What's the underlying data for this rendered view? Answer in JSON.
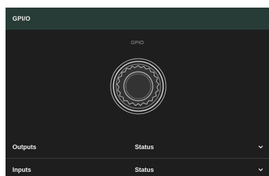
{
  "panel": {
    "title": "GPI/O"
  },
  "connector": {
    "label": "GPIO",
    "icon": "gpio-connector-icon"
  },
  "sections": [
    {
      "name": "Outputs",
      "status_label": "Status",
      "icon": "chevron-down-icon"
    },
    {
      "name": "Inputs",
      "status_label": "Status",
      "icon": "chevron-down-icon"
    }
  ],
  "colors": {
    "header_bg": "#273c36",
    "panel_bg": "#1e1e1e",
    "text": "#f2f2f2",
    "muted_text": "#9a9a9a"
  }
}
